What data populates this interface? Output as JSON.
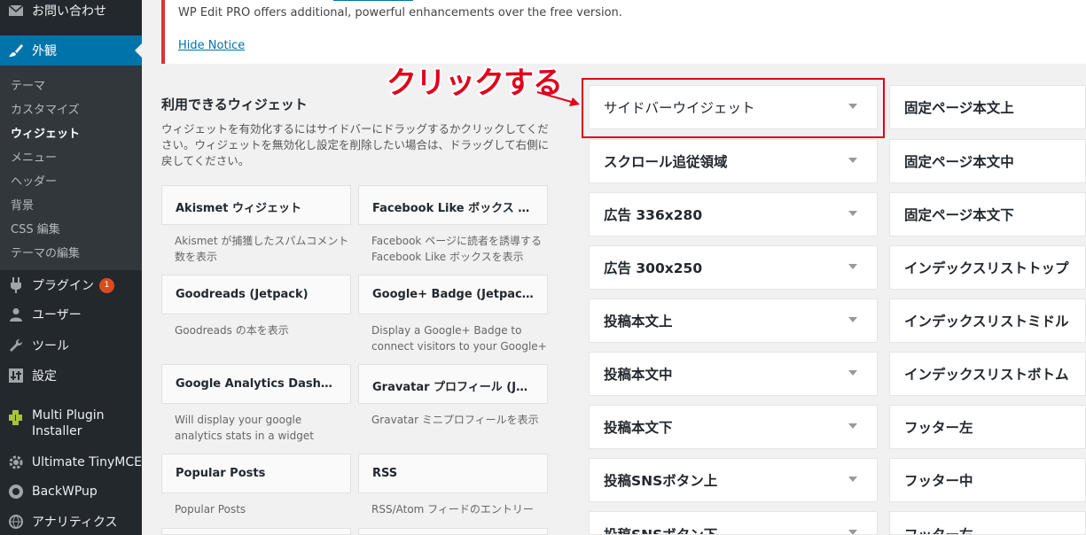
{
  "sidebar": {
    "contact": "お問い合わせ",
    "appearance": "外観",
    "submenu": [
      "テーマ",
      "カスタマイズ",
      "ウィジェット",
      "メニュー",
      "ヘッダー",
      "背景",
      "CSS 編集",
      "テーマの編集"
    ],
    "plugins": "プラグイン",
    "plugins_badge": "1",
    "users": "ユーザー",
    "tools": "ツール",
    "settings": "設定",
    "multi_plugin": "Multi Plugin Installer",
    "tinymce": "Ultimate TinyMCE",
    "backwpup": "BackWPup",
    "analytics": "アナリティクス"
  },
  "notice": {
    "text": "WP Edit PRO offers additional, powerful enhancements over the free version.",
    "hide": "Hide Notice"
  },
  "available": {
    "title": "利用できるウィジェット",
    "description": "ウィジェットを有効化するにはサイドバーにドラッグするかクリックしてください。ウィジェットを無効化し設定を削除したい場合は、ドラッグして右側に戻してください。",
    "widgets": [
      {
        "title": "Akismet ウィジェット",
        "desc": "Akismet が捕獲したスパムコメント数を表示"
      },
      {
        "title": "Facebook Like ボックス (Jetpack)",
        "desc": "Facebook ページに読者を誘導する Facebook Like ボックスを表示"
      },
      {
        "title": "Goodreads (Jetpack)",
        "desc": "Goodreads の本を表示"
      },
      {
        "title": "Google+ Badge (Jetpack)",
        "desc": "Display a Google+ Badge to connect visitors to your Google+"
      },
      {
        "title": "Google Analytics Dashboard",
        "desc": "Will display your google analytics stats in a widget"
      },
      {
        "title": "Gravatar プロフィール (Jetpack)",
        "desc": "Gravatar ミニプロフィールを表示"
      },
      {
        "title": "Popular Posts",
        "desc": "Popular Posts"
      },
      {
        "title": "RSS",
        "desc": "RSS/Atom フィードのエントリー"
      }
    ]
  },
  "sidebars_left": [
    "サイドバーウイジェット",
    "スクロール追従領域",
    "広告 336x280",
    "広告 300x250",
    "投稿本文上",
    "投稿本文中",
    "投稿本文下",
    "投稿SNSボタン上",
    "投稿SNSボタン下"
  ],
  "sidebars_right": [
    "固定ページ本文上",
    "固定ページ本文中",
    "固定ページ本文下",
    "インデックスリストトップ",
    "インデックスリストミドル",
    "インデックスリストボトム",
    "フッター左",
    "フッター中",
    "フッター右"
  ],
  "annotation": {
    "text": "クリックする",
    "color": "#e0001b"
  },
  "colors": {
    "sidebar_bg": "#23282d",
    "accent": "#0073aa",
    "notice_border": "#dc3232"
  }
}
